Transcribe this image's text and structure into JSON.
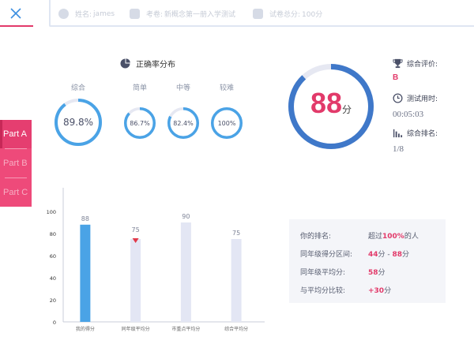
{
  "header": {
    "name_label": "姓名:",
    "name_value": "james",
    "exam_label": "考卷:",
    "exam_value": "新概念第一册入学测试",
    "total_label": "试卷总分:",
    "total_value": "100分"
  },
  "side_tabs": [
    "Part A",
    "Part B",
    "Part C"
  ],
  "accuracy": {
    "title": "正确率分布",
    "rings": [
      {
        "label": "综合",
        "value": "89.8%",
        "fraction": 0.898
      },
      {
        "label": "简单",
        "value": "86.7%",
        "fraction": 0.867
      },
      {
        "label": "中等",
        "value": "82.4%",
        "fraction": 0.824
      },
      {
        "label": "较难",
        "value": "100%",
        "fraction": 1.0
      }
    ]
  },
  "score": {
    "value": "88",
    "unit": "分",
    "fraction": 0.88
  },
  "meta": {
    "rating_label": "综合评价:",
    "rating_value": "B",
    "time_label": "测试用时:",
    "time_value": "00:05:03",
    "rank_label": "综合排名:",
    "rank_value": "1/8"
  },
  "chart_data": {
    "type": "bar",
    "categories": [
      "我的得分",
      "同年级平均分",
      "市重点平均分",
      "综合平均分"
    ],
    "values": [
      88,
      75,
      90,
      75
    ],
    "ylim": [
      0,
      100
    ],
    "yticks": [
      "0",
      "20",
      "40",
      "60",
      "80",
      "100"
    ],
    "highlight_color": "#4aa3e6",
    "bar_color": "#e3e6f4",
    "marker_color": "#e23a4a"
  },
  "ranking": {
    "rows": [
      {
        "label": "你的排名:",
        "prefix": "超过",
        "hi": "100%",
        "suffix": "的人"
      },
      {
        "label": "同年级得分区间:",
        "prefix": "",
        "hi": "44",
        "suffix": "分 - ",
        "hi2": "88",
        "suffix2": "分"
      },
      {
        "label": "同年级平均分:",
        "prefix": "",
        "hi": "58",
        "suffix": "分"
      },
      {
        "label": "与平均分比较:",
        "prefix": "",
        "hi": "+30",
        "suffix": "分"
      }
    ]
  },
  "colors": {
    "accent": "#e23a6a",
    "ring": "#4aa3e6",
    "ring_track": "#e6e8f2",
    "score_ring": "#3f78c9"
  },
  "icons": {
    "close": "close-icon",
    "avatar": "user-icon",
    "exam": "document-icon",
    "flag": "flag-icon",
    "pie": "pie-chart-icon",
    "trophy": "trophy-icon",
    "clock": "clock-icon",
    "bars": "bar-chart-icon"
  }
}
